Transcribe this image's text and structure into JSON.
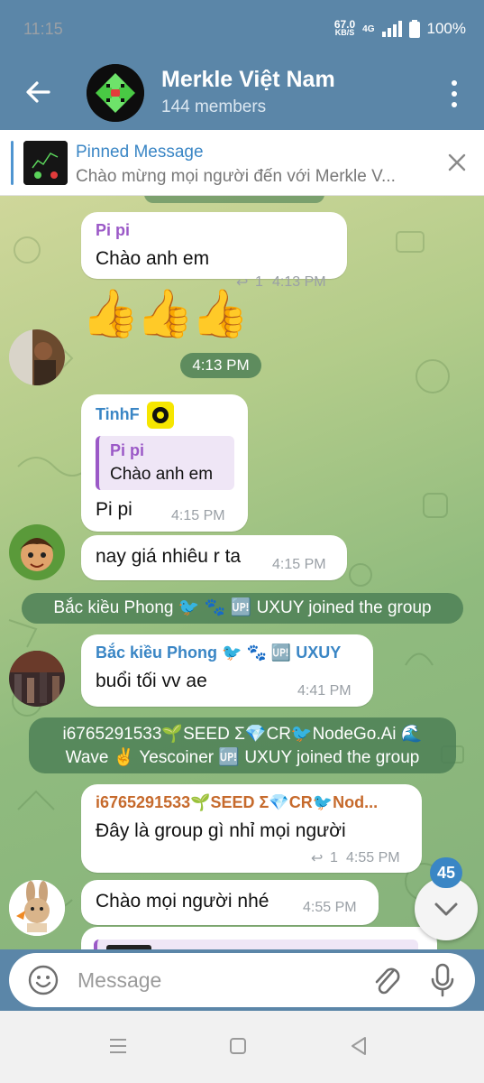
{
  "status": {
    "time": "11:15",
    "net_speed": "67.0",
    "net_unit": "KB/S",
    "network": "4G",
    "battery": "100%"
  },
  "header": {
    "title": "Merkle Việt Nam",
    "subtitle": "144 members"
  },
  "pinned": {
    "title": "Pinned Message",
    "text": "Chào mừng mọi người đến với Merkle V..."
  },
  "messages": {
    "m1": {
      "sender": "Pi pi",
      "text": "Chào anh em",
      "replies": "1",
      "time": "4:13 PM"
    },
    "emoji": {
      "text": "👍👍👍"
    },
    "date_chip": "4:13 PM",
    "m2": {
      "sender": "TinhF",
      "quote_sender": "Pi pi",
      "quote_text": "Chào anh em",
      "text": "Pi pi",
      "time": "4:15 PM"
    },
    "m3": {
      "text": "nay giá nhiêu r ta",
      "time": "4:15 PM"
    },
    "svc1": "Bắc kiều Phong 🐦 🐾 🆙 UXUY joined the group",
    "m4": {
      "sender": "Bắc kiều Phong 🐦 🐾 🆙 UXUY",
      "text": "buổi tối vv ae",
      "time": "4:41 PM"
    },
    "svc2_line1": "i6765291533🌱SEED Σ💎CR🐦NodeGo.Ai 🌊",
    "svc2_line2": "Wave ✌️ Yescoiner 🆙 UXUY joined the group",
    "m5": {
      "sender": "i6765291533🌱SEED Σ💎CR🐦Nod...",
      "text": "Đây là group gì nhỉ mọi người",
      "replies": "1",
      "time": "4:55 PM"
    },
    "m6": {
      "text": "Chào mọi người nhé",
      "time": "4:55 PM"
    }
  },
  "scroll_badge": "45",
  "composer": {
    "placeholder": "Message"
  },
  "colors": {
    "header": "#5b86a8",
    "accent": "#3a86c5",
    "sender_purple": "#9b59c7",
    "sender_blue": "#3a86c5",
    "sender_orange": "#c66a2c"
  }
}
